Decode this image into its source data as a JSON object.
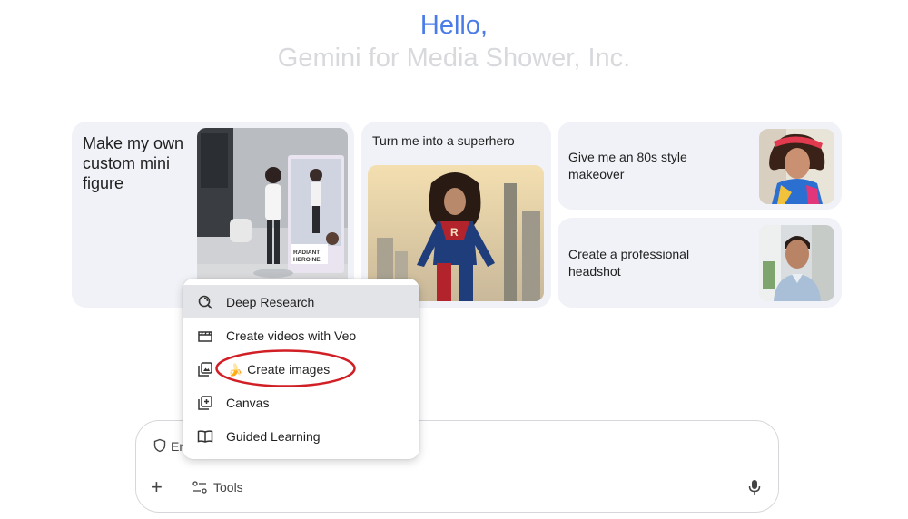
{
  "greeting": {
    "hello": "Hello,",
    "subtitle": "Gemini for Media Shower, Inc."
  },
  "cards": [
    {
      "label": "Make my own custom mini figure",
      "image": "mini-figure-desk-photo",
      "image_text": "RADIANT HEROINE"
    },
    {
      "label": "Turn me into a superhero",
      "image": "superhero-city-photo"
    },
    {
      "label": "Give me an 80s style makeover",
      "image": "80s-makeover-portrait"
    },
    {
      "label": "Create a professional headshot",
      "image": "professional-headshot-portrait"
    }
  ],
  "menu": {
    "items": [
      {
        "label": "Deep Research",
        "icon": "deep-research-icon",
        "active": true
      },
      {
        "label": "Create videos with Veo",
        "icon": "clapperboard-icon"
      },
      {
        "label": "Create images",
        "icon": "image-gallery-icon",
        "emoji": "🍌"
      },
      {
        "label": "Canvas",
        "icon": "canvas-icon"
      },
      {
        "label": "Guided Learning",
        "icon": "open-book-icon"
      }
    ]
  },
  "composer": {
    "partial_text": "En",
    "tools_label": "Tools",
    "icons": [
      "shield-icon",
      "plus-icon",
      "tools-icon",
      "microphone-icon"
    ]
  },
  "colors": {
    "hello_blue": "#4a7ce8",
    "subtitle_gray": "#d8d9dd",
    "card_bg": "#f0f2f7",
    "menu_active": "#e3e4e8",
    "annotation_red": "#d11f26"
  }
}
